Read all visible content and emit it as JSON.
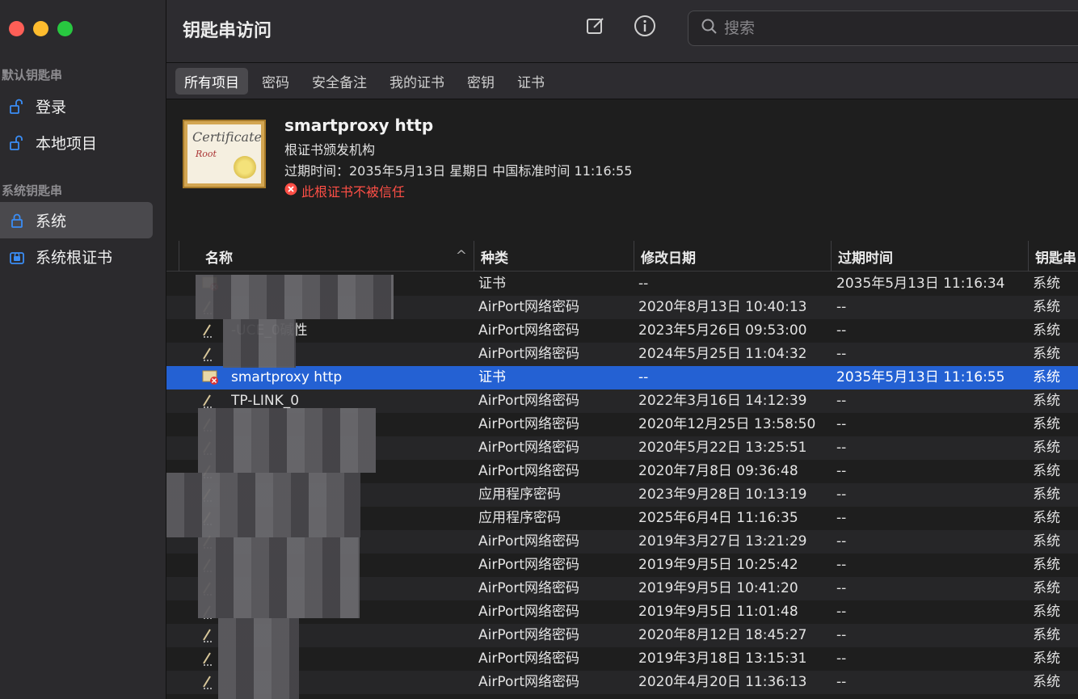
{
  "colors": {
    "accent": "#2461d3",
    "warning": "#ff4f46",
    "sidebar_bg": "#2b2a2d"
  },
  "window": {
    "title": "钥匙串访问"
  },
  "sidebar": {
    "default_section": "默认钥匙串",
    "system_section": "系统钥匙串",
    "items": [
      {
        "label": "登录",
        "icon": "unlock-icon"
      },
      {
        "label": "本地项目",
        "icon": "unlock-icon"
      },
      {
        "label": "系统",
        "icon": "lock-icon"
      },
      {
        "label": "系统根证书",
        "icon": "locked-cabinet-icon"
      }
    ]
  },
  "toolbar": {
    "compose_icon": "compose-icon",
    "info_icon": "info-icon"
  },
  "search": {
    "placeholder": "搜索"
  },
  "tabs": [
    "所有项目",
    "密码",
    "安全备注",
    "我的证书",
    "密钥",
    "证书"
  ],
  "detail": {
    "name": "smartproxy http",
    "type": "根证书颁发机构",
    "expiry": "过期时间：2035年5月13日 星期日 中国标准时间 11:16:55",
    "warning": "此根证书不被信任",
    "cert_script": "Certificate",
    "cert_root": "Root"
  },
  "table": {
    "columns": [
      "名称",
      "种类",
      "修改日期",
      "过期时间",
      "钥匙串"
    ],
    "rows": [
      {
        "name": "",
        "kind": "证书",
        "date": "--",
        "exp": "2035年5月13日 11:16:34",
        "kc": "系统"
      },
      {
        "name": "",
        "kind": "AirPort网络密码",
        "date": "2020年8月13日 10:40:13",
        "exp": "--",
        "kc": "系统"
      },
      {
        "name": "-UCE_0碱性",
        "kind": "AirPort网络密码",
        "date": "2023年5月26日 09:53:00",
        "exp": "--",
        "kc": "系统"
      },
      {
        "name": "",
        "kind": "AirPort网络密码",
        "date": "2024年5月25日 11:04:32",
        "exp": "--",
        "kc": "系统"
      },
      {
        "name": "smartproxy http",
        "kind": "证书",
        "date": "--",
        "exp": "2035年5月13日 11:16:55",
        "kc": "系统"
      },
      {
        "name": "TP-LINK_0",
        "kind": "AirPort网络密码",
        "date": "2022年3月16日 14:12:39",
        "exp": "--",
        "kc": "系统"
      },
      {
        "name": "",
        "kind": "AirPort网络密码",
        "date": "2020年12月25日 13:58:50",
        "exp": "--",
        "kc": "系统"
      },
      {
        "name": "",
        "kind": "AirPort网络密码",
        "date": "2020年5月22日 13:25:51",
        "exp": "--",
        "kc": "系统"
      },
      {
        "name": "",
        "kind": "AirPort网络密码",
        "date": "2020年7月8日 09:36:48",
        "exp": "--",
        "kc": "系统"
      },
      {
        "name": "",
        "kind": "应用程序密码",
        "date": "2023年9月28日 10:13:19",
        "exp": "--",
        "kc": "系统"
      },
      {
        "name": "",
        "kind": "应用程序密码",
        "date": "2025年6月4日 11:16:35",
        "exp": "--",
        "kc": "系统"
      },
      {
        "name": "",
        "kind": "AirPort网络密码",
        "date": "2019年3月27日 13:21:29",
        "exp": "--",
        "kc": "系统"
      },
      {
        "name": "",
        "kind": "AirPort网络密码",
        "date": "2019年9月5日 10:25:42",
        "exp": "--",
        "kc": "系统"
      },
      {
        "name": "",
        "kind": "AirPort网络密码",
        "date": "2019年9月5日 10:41:20",
        "exp": "--",
        "kc": "系统"
      },
      {
        "name": "",
        "kind": "AirPort网络密码",
        "date": "2019年9月5日 11:01:48",
        "exp": "--",
        "kc": "系统"
      },
      {
        "name": "",
        "kind": "AirPort网络密码",
        "date": "2020年8月12日 18:45:27",
        "exp": "--",
        "kc": "系统"
      },
      {
        "name": "",
        "kind": "AirPort网络密码",
        "date": "2019年3月18日 13:15:31",
        "exp": "--",
        "kc": "系统"
      },
      {
        "name": "",
        "kind": "AirPort网络密码",
        "date": "2020年4月20日 11:36:13",
        "exp": "--",
        "kc": "系统"
      }
    ]
  }
}
